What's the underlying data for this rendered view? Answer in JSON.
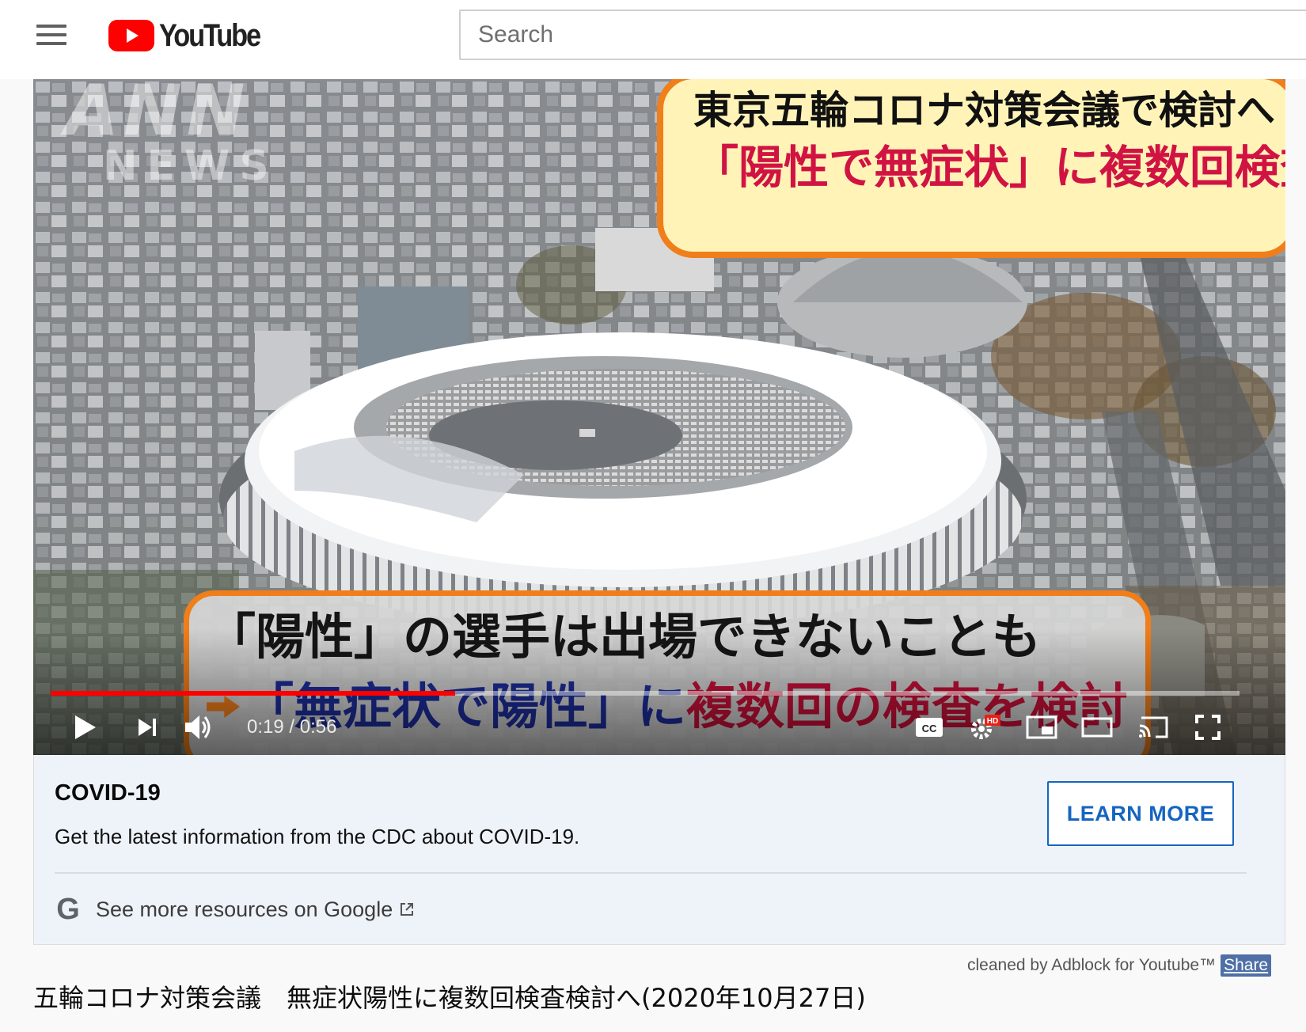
{
  "header": {
    "logo_text": "YouTube",
    "search_placeholder": "Search"
  },
  "video": {
    "watermark_top": "ANN",
    "watermark_bottom": "NEWS",
    "top_caption_line1": "東京五輪コロナ対策会議で検討へ",
    "top_caption_line2": "「陽性で無症状」に複数回検査",
    "bottom_caption_line1": "「陽性」の選手は出場できないことも",
    "bottom_caption_line2_blue": "「無症状で陽性」に",
    "bottom_caption_line2_red": "複数回の検査を検討",
    "progress_fraction": 0.34,
    "time_display": "0:19 / 0:56",
    "hd_badge": "HD",
    "cc_label": "CC"
  },
  "info_panel": {
    "title": "COVID-19",
    "description": "Get the latest information from the CDC about COVID-19.",
    "button_label": "LEARN MORE",
    "google_logo": "G",
    "google_link": "See more resources on Google"
  },
  "adblock": {
    "text": "cleaned by Adblock for Youtube™",
    "share_label": "Share"
  },
  "video_title": "五輪コロナ対策会議　無症状陽性に複数回検査検討へ(2020年10月27日)",
  "colors": {
    "youtube_red": "#ff0000",
    "caption_orange": "#f07e1a",
    "learn_more_blue": "#1565c0",
    "info_bg": "#eef3fa"
  }
}
